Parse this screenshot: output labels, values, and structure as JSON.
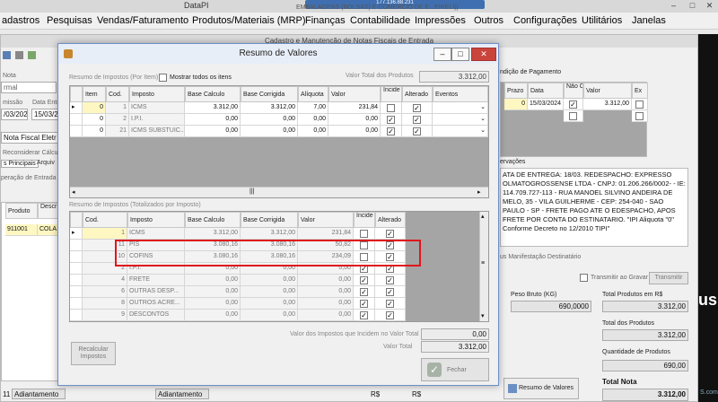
{
  "window": {
    "title": "DataPI",
    "ip": "177.136.88.231",
    "title_overlay": "EMBALAGENS (BOLSAS) E COMERCIO DE E...EIRELI))",
    "controls": [
      "–",
      "□",
      "✕"
    ]
  },
  "menu": [
    "adastros",
    "Pesquisas",
    "Vendas/Faturamento",
    "Produtos/Materiais (MRP)",
    "Finanças",
    "Contabilidade",
    "Impressões",
    "Outros",
    "Configurações",
    "Utilitários",
    "Janelas"
  ],
  "bg_form": {
    "title": "Cadastro e Manutenção de Notas Fiscais de Entrada",
    "nota_label": "Nota",
    "normal_value": "rmal",
    "emissao_label": "missão",
    "emissao_value": "/03/2024",
    "entrada_label": "Data Entra",
    "entrada_value": "15/03/2",
    "tipo_value": "Nota Fiscal Eletr",
    "reconsiderar": "Reconsiderar Cálculo C",
    "tab_principais": "s Principais",
    "tab_arquivo": "Arquiv",
    "operacao_label": "peração de Entrada",
    "prod_headers": [
      "Produto",
      "Descr Prod"
    ],
    "prod_row": [
      "911001",
      "COLA"
    ],
    "bottom_left_code": "11",
    "bottom_left_value": "Adiantamento",
    "bottom_left_value2": "Adiantamento",
    "rs1": "R$",
    "rs2": "R$",
    "obs_label": "ervações",
    "obs_text": "ATA DE ENTREGA: 18/03. REDESPACHO: EXPRESSO OLMATOGROSSENSE LTDA - CNPJ: 01.206.266/0002- - IE: 114.709.727-113 - RUA MANOEL SILVINO ANDEIRA DE MELO, 35 - VILA GUILHERME - CEP: 254-040 - SAO PAULO - SP - FRETE PAGO ATE O EDESPACHO, APOS FRETE POR CONTA DO ESTINATARIO. \"IPI Aliquota \"0\" Conforme Decreto no 12/2010 TIPI\"",
    "condicao_label": "ndição de Pagamento",
    "pay_headers": [
      "Prazo",
      "Data",
      "Não Calc.",
      "Valor",
      "Ex"
    ],
    "pay_row": {
      "prazo": "0",
      "data": "15/03/2024",
      "valor": "3.312,00"
    },
    "manifest_label": "us Manifestação Destinatário",
    "transmitir_gravar": "Transmitir ao Gravar",
    "transmitir_btn": "Transmitir",
    "peso_label": "Peso Bruto (KG)",
    "peso_value": "690,0000",
    "total_prod_rs_label": "Total Produtos em R$",
    "total_prod_rs_value": "3.312,00",
    "total_prod_label": "Total dos Produtos",
    "total_prod_value": "3.312,00",
    "qtd_label": "Quantidade de Produtos",
    "qtd_value": "690,00",
    "total_nota_label": "Total Nota",
    "total_nota_value": "3.312,00",
    "resumo_btn": "Resumo de Valores",
    "side_text": "us",
    "side_text2": "S.com"
  },
  "modal": {
    "title": "Resumo de Valores",
    "section1": "Resumo de Impostos (Por Item)",
    "mostrar_todos": "Mostrar todos os itens",
    "valor_total_produtos_label": "Valor Total dos Produtos",
    "valor_total_produtos": "3.312,00",
    "grid1_headers": [
      "Item",
      "Cod.",
      "Imposto",
      "Base Calculo",
      "Base Corrigida",
      "Alíquota",
      "Valor",
      "Incide Total",
      "Alterado",
      "Eventos"
    ],
    "grid1_rows": [
      {
        "item": "0",
        "cod": "1",
        "imposto": "ICMS",
        "base": "3.312,00",
        "corrigida": "3.312,00",
        "aliquota": "7,00",
        "valor": "231,84",
        "incide": false,
        "alterado": true
      },
      {
        "item": "0",
        "cod": "2",
        "imposto": "I.P.I.",
        "base": "0,00",
        "corrigida": "0,00",
        "aliquota": "0,00",
        "valor": "0,00",
        "incide": true,
        "alterado": true
      },
      {
        "item": "0",
        "cod": "21",
        "imposto": "ICMS SUBSTUIC...",
        "base": "0,00",
        "corrigida": "0,00",
        "aliquota": "0,00",
        "valor": "0,00",
        "incide": true,
        "alterado": true
      }
    ],
    "section2": "Resumo de Impostos (Totalizados por Imposto)",
    "grid2_headers": [
      "Cod.",
      "Imposto",
      "Base Calculo",
      "Base Corrigida",
      "Valor",
      "Incide Total",
      "Alterado"
    ],
    "grid2_rows": [
      {
        "cod": "1",
        "imposto": "ICMS",
        "base": "3.312,00",
        "corrigida": "3.312,00",
        "valor": "231,84",
        "incide": false,
        "alterado": true
      },
      {
        "cod": "11",
        "imposto": "PIS",
        "base": "3.080,16",
        "corrigida": "3.080,16",
        "valor": "50,82",
        "incide": false,
        "alterado": true
      },
      {
        "cod": "10",
        "imposto": "COFINS",
        "base": "3.080,16",
        "corrigida": "3.080,16",
        "valor": "234,09",
        "incide": false,
        "alterado": true
      },
      {
        "cod": "2",
        "imposto": "I.P.I.",
        "base": "0,00",
        "corrigida": "0,00",
        "valor": "0,00",
        "incide": true,
        "alterado": true
      },
      {
        "cod": "4",
        "imposto": "FRETE",
        "base": "0,00",
        "corrigida": "0,00",
        "valor": "0,00",
        "incide": true,
        "alterado": true
      },
      {
        "cod": "6",
        "imposto": "OUTRAS DESP...",
        "base": "0,00",
        "corrigida": "0,00",
        "valor": "0,00",
        "incide": true,
        "alterado": true
      },
      {
        "cod": "8",
        "imposto": "OUTROS ACRE...",
        "base": "0,00",
        "corrigida": "0,00",
        "valor": "0,00",
        "incide": true,
        "alterado": true
      },
      {
        "cod": "9",
        "imposto": "DESCONTOS",
        "base": "0,00",
        "corrigida": "0,00",
        "valor": "0,00",
        "incide": true,
        "alterado": true
      }
    ],
    "recalcular": "Recalcular Impostos",
    "valor_impostos_label": "Valor dos Impostos que Incidem no Valor Total",
    "valor_impostos": "0,00",
    "valor_total_label": "Valor Total",
    "valor_total": "3.312,00",
    "fechar": "Fechar",
    "highlight_color": "#e0161b"
  }
}
